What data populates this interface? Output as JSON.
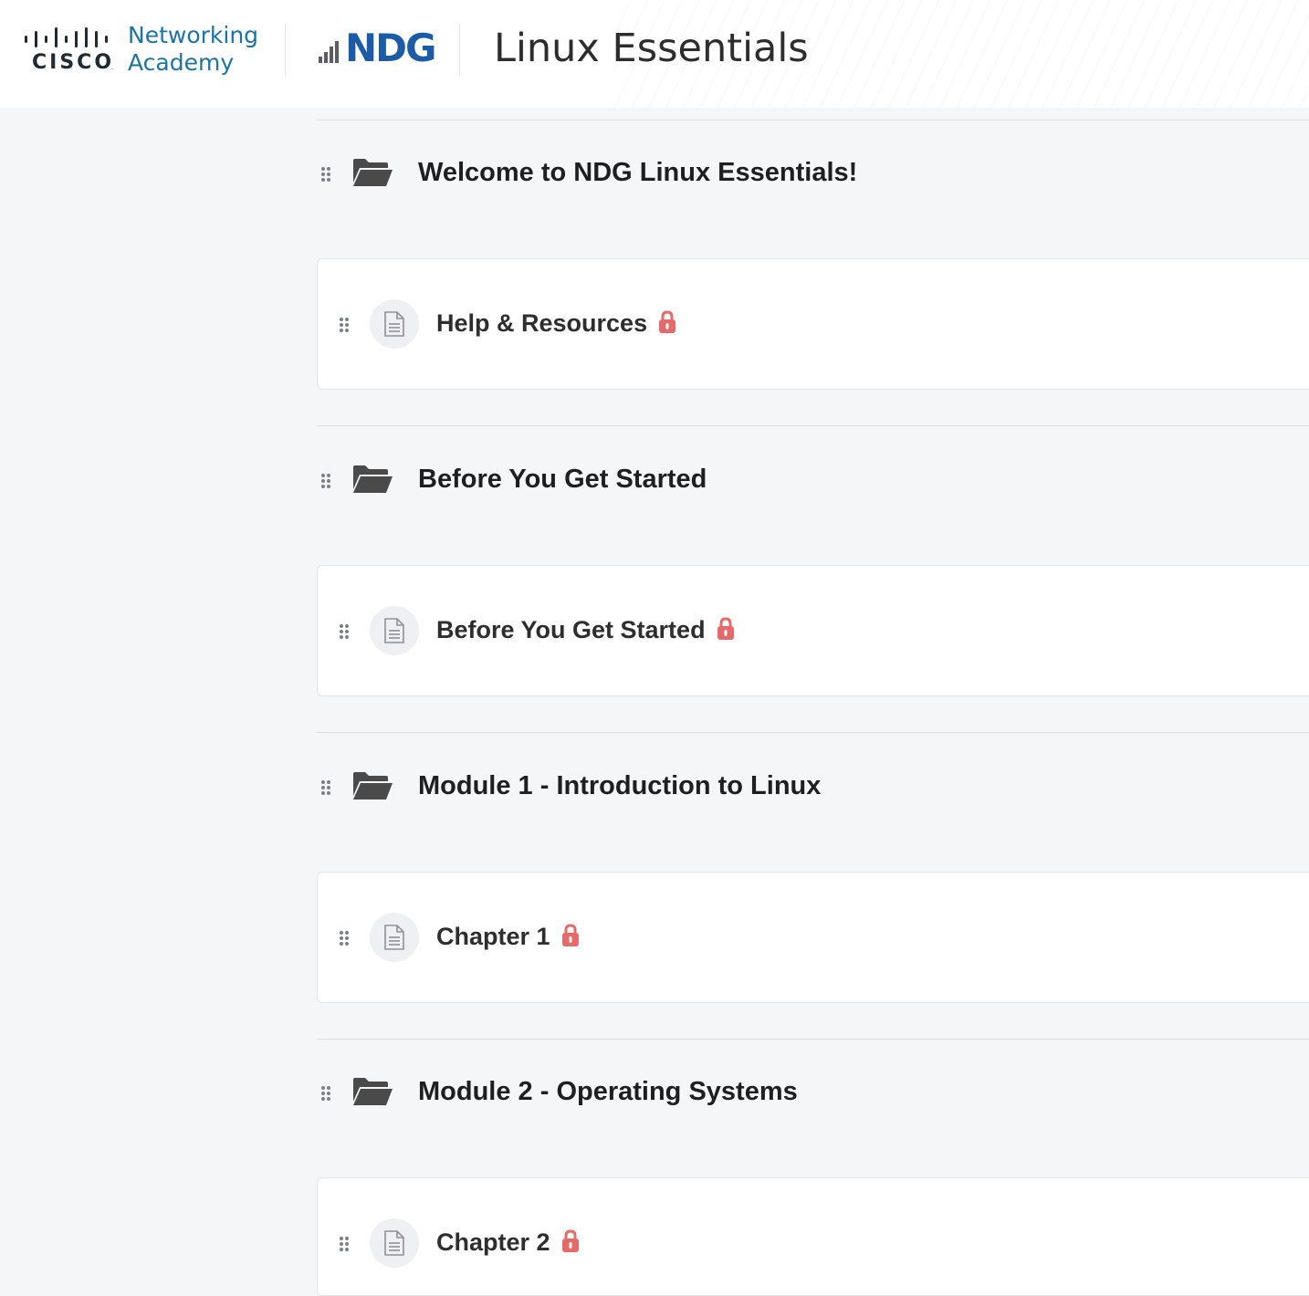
{
  "header": {
    "cisco_word": "CISCO",
    "cisco_line1": "Networking",
    "cisco_line2": "Academy",
    "ndg_word": "NDG",
    "app_title": "Linux Essentials"
  },
  "colors": {
    "cisco_blue": "#1b74a5",
    "ndg_blue": "#1c5ba6",
    "lock_red": "#e56b6b",
    "page_bg": "#f4f6f8"
  },
  "sections": [
    {
      "title": "Welcome to NDG Linux Essentials!",
      "icon": "folder-open-icon",
      "items": [
        {
          "title": "Help & Resources",
          "icon": "document-icon",
          "status_icon": "lock-icon"
        }
      ]
    },
    {
      "title": "Before You Get Started",
      "icon": "folder-open-icon",
      "items": [
        {
          "title": "Before You Get Started",
          "icon": "document-icon",
          "status_icon": "lock-icon"
        }
      ]
    },
    {
      "title": "Module 1 - Introduction to Linux",
      "icon": "folder-open-icon",
      "items": [
        {
          "title": "Chapter 1",
          "icon": "document-icon",
          "status_icon": "lock-icon"
        }
      ]
    },
    {
      "title": "Module 2 - Operating Systems",
      "icon": "folder-open-icon",
      "items": [
        {
          "title": "Chapter 2",
          "icon": "document-icon",
          "status_icon": "lock-icon"
        }
      ]
    }
  ]
}
